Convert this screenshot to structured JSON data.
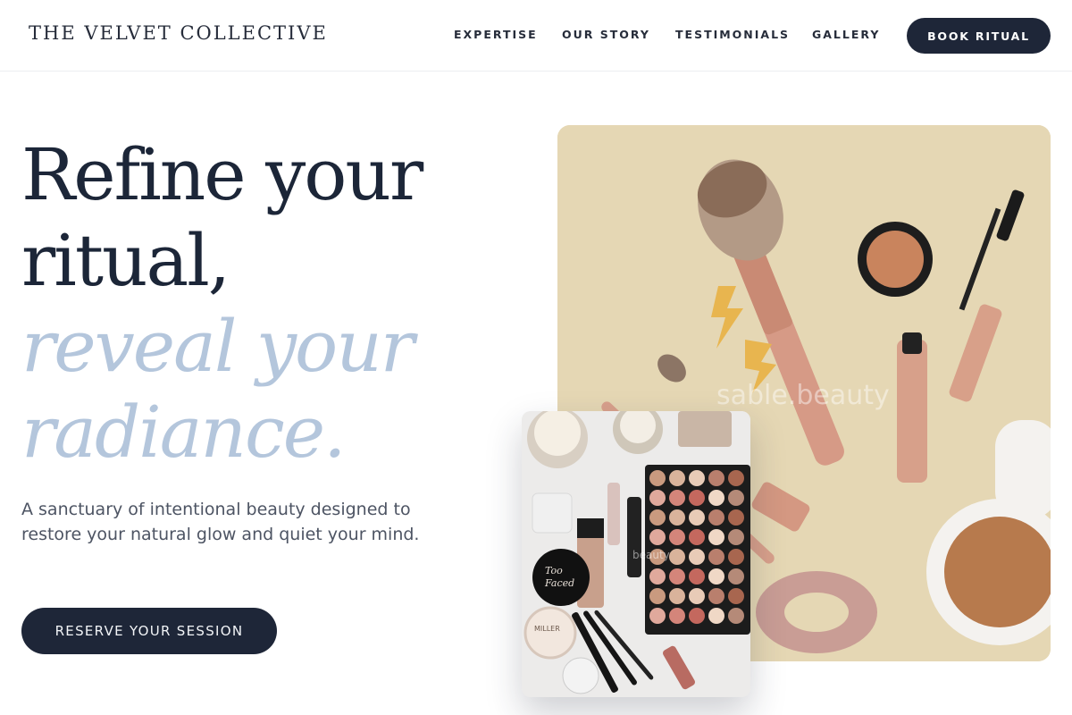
{
  "brand": "THE VELVET COLLECTIVE",
  "nav": {
    "expertise": "EXPERTISE",
    "our_story": "OUR STORY",
    "testimonials": "TESTIMONIALS",
    "gallery": "GALLERY",
    "book_button": "BOOK RITUAL"
  },
  "hero": {
    "line1": "Refine your",
    "line2": "ritual,",
    "line3": "reveal your",
    "line4": "radiance.",
    "subtitle": "A sanctuary of intentional beauty designed to restore your natural glow and quiet your mind.",
    "cta": "RESERVE YOUR SESSION"
  },
  "images": {
    "main_watermark": "sable.beauty",
    "inset_watermark": "beauty",
    "tube_label_1": "Too",
    "tube_label_2": "Faced",
    "jar_label": "MILLER"
  },
  "colors": {
    "navy": "#1e2638",
    "soft_blue": "#b4c6dc",
    "sand": "#e5d7b4",
    "blush": "#d9a38e"
  }
}
